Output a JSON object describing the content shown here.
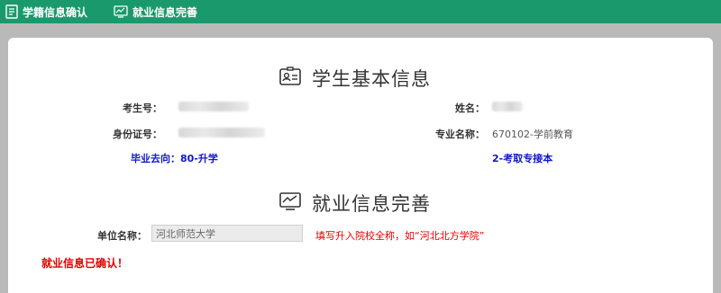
{
  "nav": {
    "items": [
      {
        "label": "学籍信息确认",
        "icon": "document-list-icon"
      },
      {
        "label": "就业信息完善",
        "icon": "monitor-chart-icon"
      }
    ]
  },
  "basic_info": {
    "title": "学生基本信息",
    "exam_no_label": "考生号：",
    "exam_no_value": "",
    "name_label": "姓名：",
    "name_value": "",
    "id_label": "身份证号：",
    "id_value": "",
    "major_label": "专业名称：",
    "major_value": "670102-学前教育",
    "destination_label": "毕业去向：",
    "destination_value": "80-升学",
    "path_value": "2-考取专接本"
  },
  "employment": {
    "title": "就业信息完善",
    "unit_label": "单位名称：",
    "unit_value": "河北师范大学",
    "hint": "填写升入院校全称，如“河北北方学院”",
    "status": "就业信息已确认！"
  },
  "colors": {
    "header": "#1a9a6c",
    "accent_blue": "#1018c8",
    "alert_red": "#e00000"
  }
}
